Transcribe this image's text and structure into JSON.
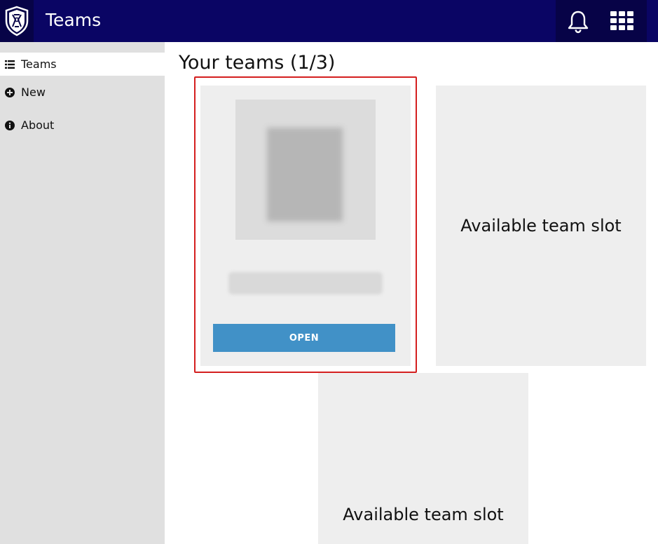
{
  "header": {
    "title": "Teams",
    "logo_icon": "shield-logo-icon",
    "notifications_icon": "bell-icon",
    "apps_icon": "grid-icon",
    "background": "#0a0564"
  },
  "sidebar": {
    "items": [
      {
        "label": "Teams",
        "icon": "list-icon",
        "active": true
      },
      {
        "label": "New",
        "icon": "plus-circle-icon",
        "active": false
      },
      {
        "label": "About",
        "icon": "info-circle-icon",
        "active": false
      }
    ]
  },
  "main": {
    "title": "Your teams (1/3)",
    "team_card": {
      "open_label": "OPEN"
    },
    "slots": [
      {
        "label": "Available team slot"
      },
      {
        "label": "Available team slot"
      }
    ]
  },
  "colors": {
    "accent_button": "#4191c7",
    "highlight_border": "#d41f1f",
    "sidebar_bg": "#e0e0e0",
    "card_bg": "#eeeeee"
  }
}
